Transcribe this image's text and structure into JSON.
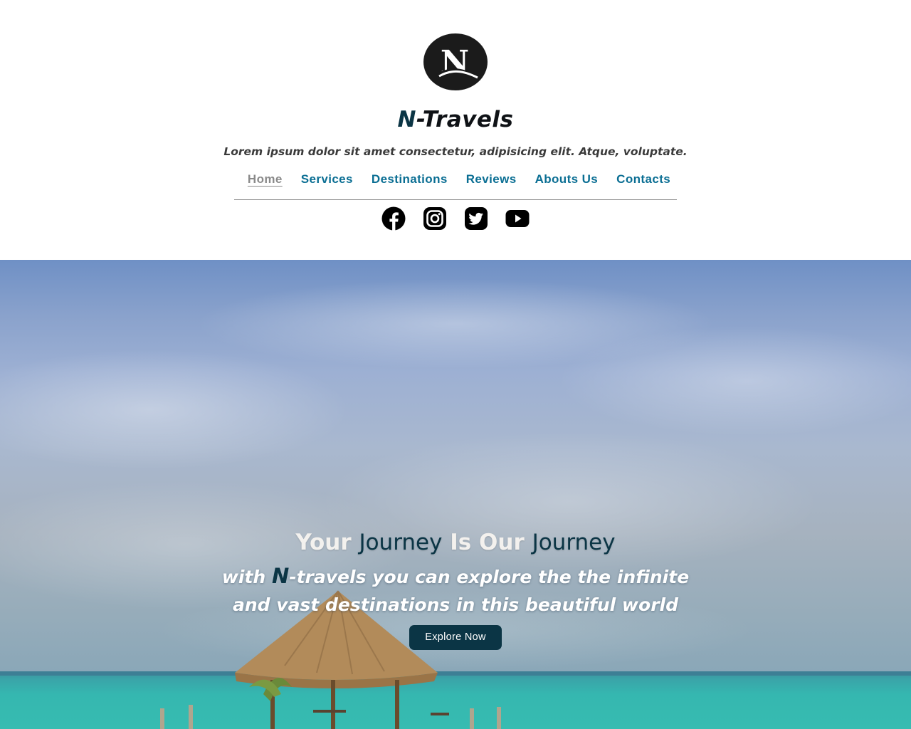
{
  "header": {
    "logo_letter": "N",
    "brand_prefix": "N",
    "brand_rest": "-Travels",
    "tagline": "Lorem ipsum dolor sit amet consectetur, adipisicing elit. Atque, voluptate."
  },
  "nav": {
    "items": [
      {
        "label": "Home",
        "active": true
      },
      {
        "label": "Services"
      },
      {
        "label": "Destinations"
      },
      {
        "label": "Reviews"
      },
      {
        "label": "Abouts Us"
      },
      {
        "label": "Contacts"
      }
    ]
  },
  "socials": [
    "facebook-icon",
    "instagram-icon",
    "twitter-icon",
    "youtube-icon"
  ],
  "hero": {
    "title_1": "Your ",
    "title_2": "Journey",
    "title_3": " Is Our ",
    "title_4": "Journey",
    "sub_1": "with ",
    "sub_brand": "N",
    "sub_2": "-travels you can explore the the infinite",
    "sub_3": "and vast destinations in this beautiful world",
    "button": "Explore Now"
  },
  "colors": {
    "brand_dark": "#0b3545",
    "nav_link": "#0a6e93",
    "nav_active": "#8a8a8a",
    "button_bg": "#0b3545"
  }
}
